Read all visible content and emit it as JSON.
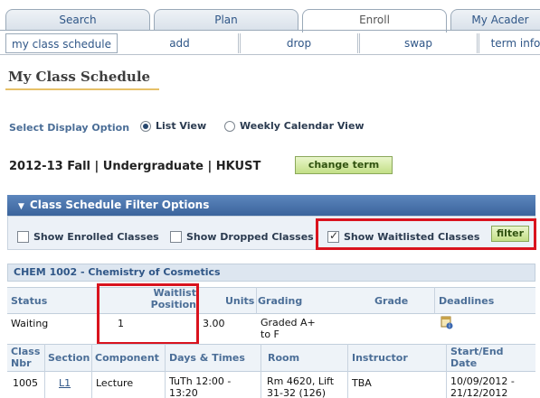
{
  "tabs": [
    {
      "label": "Search"
    },
    {
      "label": "Plan"
    },
    {
      "label": "Enroll",
      "active": true
    },
    {
      "label": "My Acader"
    }
  ],
  "subtabs": [
    {
      "label": "my class schedule",
      "active": true
    },
    {
      "label": "add"
    },
    {
      "label": "drop"
    },
    {
      "label": "swap"
    },
    {
      "label": "term info"
    }
  ],
  "page_title": "My Class Schedule",
  "display_option": {
    "label": "Select Display Option",
    "options": [
      {
        "label": "List View",
        "selected": true
      },
      {
        "label": "Weekly Calendar View",
        "selected": false
      }
    ]
  },
  "term": {
    "text": "2012-13 Fall | Undergraduate | HKUST",
    "change_button": "change term"
  },
  "filter": {
    "header": "Class Schedule Filter Options",
    "checkboxes": [
      {
        "label": "Show Enrolled Classes",
        "checked": false
      },
      {
        "label": "Show Dropped Classes",
        "checked": false
      },
      {
        "label": "Show Waitlisted Classes",
        "checked": true
      }
    ],
    "filter_button": "filter"
  },
  "course": {
    "title": "CHEM 1002 - Chemistry of Cosmetics",
    "summary_headers": {
      "status": "Status",
      "waitlist": "Waitlist Position",
      "units": "Units",
      "grading": "Grading",
      "grade": "Grade",
      "deadlines": "Deadlines"
    },
    "summary": {
      "status": "Waiting",
      "waitlist": "1",
      "units": "3.00",
      "grading": "Graded A+ to F",
      "grade": ""
    },
    "section_headers": {
      "class_nbr": "Class Nbr",
      "section": "Section",
      "component": "Component",
      "days_times": "Days & Times",
      "room": "Room",
      "instructor": "Instructor",
      "dates": "Start/End Date"
    },
    "sections": [
      {
        "class_nbr": "1005",
        "section": "L1",
        "component": "Lecture",
        "days_times": "TuTh 12:00 - 13:20",
        "room": "Rm 4620, Lift 31-32 (126)",
        "instructor": "TBA",
        "dates": "10/09/2012 - 21/12/2012"
      }
    ]
  },
  "colors": {
    "link": "#2f5687",
    "highlight": "#d9131e",
    "filter_bar": "#4a74ad",
    "button_green": "#c3df86"
  }
}
